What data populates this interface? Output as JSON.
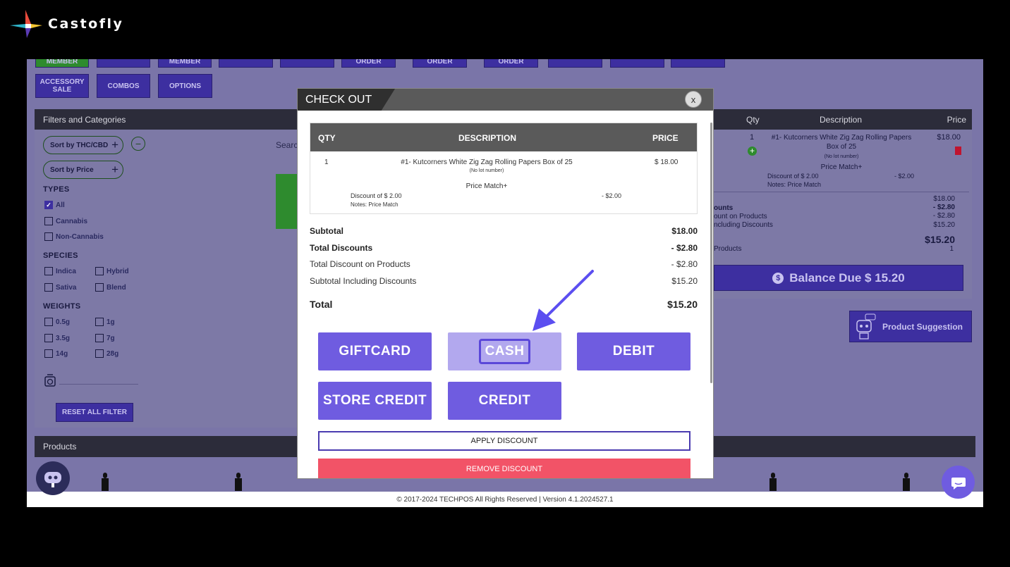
{
  "brand": {
    "name": "Castofly"
  },
  "toolbar": {
    "row1": [
      "MEMBER",
      "",
      "MEMBER",
      "",
      "",
      "ORDER",
      "ORDER",
      "ORDER",
      "",
      "",
      ""
    ],
    "row2": [
      "ACCESSORY SALE",
      "COMBOS",
      "OPTIONS"
    ]
  },
  "filters": {
    "header": "Filters and Categories",
    "sort_thc": "Sort by THC/CBD",
    "sort_price": "Sort by Price",
    "search_placeholder": "Search",
    "types_label": "TYPES",
    "types": [
      "All",
      "Cannabis",
      "Non-Cannabis"
    ],
    "species_label": "SPECIES",
    "species": [
      "Indica",
      "Hybrid",
      "Sativa",
      "Blend"
    ],
    "weights_label": "WEIGHTS",
    "weights": [
      "0.5g",
      "1g",
      "3.5g",
      "7g",
      "14g",
      "28g"
    ],
    "reset": "RESET ALL FILTER"
  },
  "products": {
    "header": "Products"
  },
  "cart": {
    "headers": {
      "qty": "Qty",
      "description": "Description",
      "price": "Price"
    },
    "item": {
      "qty": "1",
      "description": "#1- Kutcorners White Zig Zag Rolling Papers Box of 25",
      "lot": "(No lot number)",
      "price_match": "Price Match+",
      "discount": "Discount of $ 2.00",
      "discount_amount": "- $2.00",
      "notes": "Notes: Price Match",
      "price": "$18.00"
    },
    "summary": {
      "discounts_label": "ounts",
      "on_products_label": "ount on Products",
      "including_label": "ncluding Discounts",
      "products_label": "Products",
      "subtotal": "$18.00",
      "discounts": "- $2.80",
      "on_products": "- $2.80",
      "including": "$15.20",
      "total": "$15.20",
      "count": "1"
    },
    "balance_due": "Balance Due $ 15.20",
    "product_suggestion": "Product Suggestion"
  },
  "modal": {
    "title": "CHECK OUT",
    "close": "x",
    "table_headers": {
      "qty": "QTY",
      "description": "DESCRIPTION",
      "price": "PRICE"
    },
    "line": {
      "qty": "1",
      "description": "#1- Kutcorners White Zig Zag Rolling Papers Box of 25",
      "lot": "(No lot number)",
      "price": "$ 18.00",
      "price_match": "Price Match+",
      "discount": "Discount of $ 2.00",
      "discount_amount": "- $2.00",
      "notes": "Notes: Price Match"
    },
    "summary": [
      {
        "label": "Subtotal",
        "value": "$18.00",
        "bold": true
      },
      {
        "label": "Total Discounts",
        "value": "- $2.80",
        "bold": true
      },
      {
        "label": "Total Discount on Products",
        "value": "- $2.80",
        "bold": false
      },
      {
        "label": "Subtotal Including Discounts",
        "value": "$15.20",
        "bold": false
      }
    ],
    "total_label": "Total",
    "total_value": "$15.20",
    "payments": {
      "giftcard": "GIFTCARD",
      "cash": "CASH",
      "debit": "DEBIT",
      "store_credit": "STORE CREDIT",
      "credit": "CREDIT"
    },
    "apply_discount": "APPLY DISCOUNT",
    "remove_discount": "REMOVE DISCOUNT"
  },
  "footer": {
    "text": "© 2017-2024 TECHPOS All Rights Reserved | Version 4.1.2024527.1"
  },
  "colors": {
    "accent": "#6f5ce0",
    "danger": "#f25367",
    "arrow": "#5b4ef0"
  }
}
